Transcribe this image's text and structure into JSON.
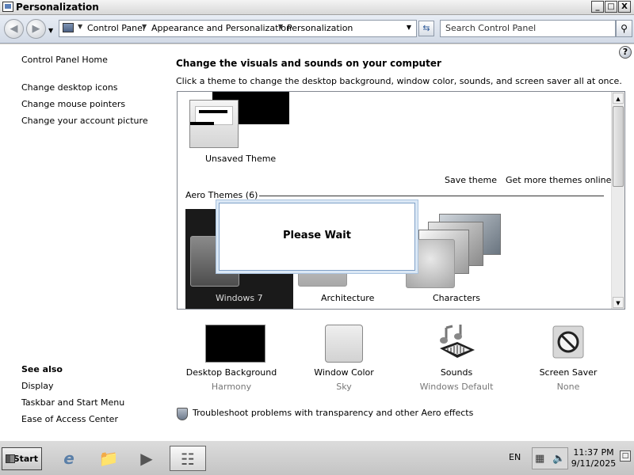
{
  "window": {
    "title": "Personalization"
  },
  "window_buttons": {
    "minimize": "_",
    "maximize": "□",
    "close": "X"
  },
  "address": {
    "crumbs": [
      "Control Panel",
      "Appearance and Personalization",
      "Personalization"
    ],
    "search_placeholder": "Search Control Panel"
  },
  "leftnav": {
    "home": "Control Panel Home",
    "links": [
      "Change desktop icons",
      "Change mouse pointers",
      "Change your account picture"
    ],
    "see_also_title": "See also",
    "see_also": [
      "Display",
      "Taskbar and Start Menu",
      "Ease of Access Center"
    ]
  },
  "main": {
    "heading": "Change the visuals and sounds on your computer",
    "subheading": "Click a theme to change the desktop background, window color, sounds, and screen saver all at once.",
    "unsaved_theme": "Unsaved Theme",
    "save_theme": "Save theme",
    "get_more": "Get more themes online",
    "aero_group": "Aero Themes (6)",
    "themes": [
      "Windows 7",
      "Architecture",
      "Characters"
    ],
    "dialog_text": "Please Wait"
  },
  "bottom": {
    "items": [
      {
        "label": "Desktop Background",
        "sub": "Harmony"
      },
      {
        "label": "Window Color",
        "sub": "Sky"
      },
      {
        "label": "Sounds",
        "sub": "Windows Default"
      },
      {
        "label": "Screen Saver",
        "sub": "None"
      }
    ],
    "troubleshoot": "Troubleshoot problems with transparency and other Aero effects"
  },
  "taskbar": {
    "start": "Start",
    "language": "EN",
    "time": "11:37 PM",
    "date": "9/11/2025"
  }
}
